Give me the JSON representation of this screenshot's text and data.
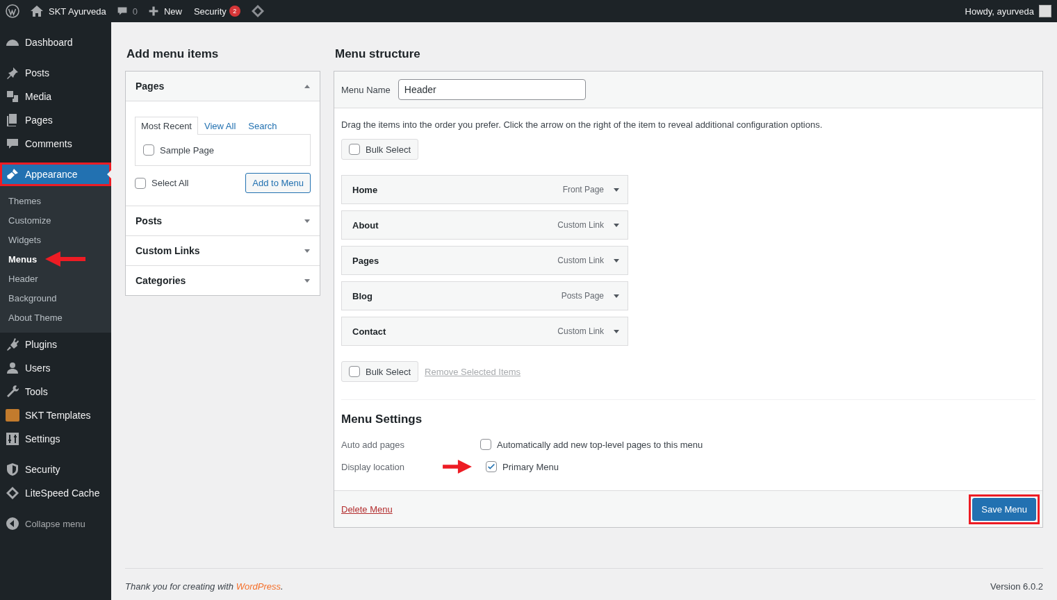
{
  "admin_bar": {
    "site_name": "SKT Ayurveda",
    "comments_count": "0",
    "new_label": "New",
    "security_label": "Security",
    "security_badge": "2",
    "greeting": "Howdy, ayurveda"
  },
  "sidebar": {
    "groups": [
      {
        "items": [
          {
            "label": "Dashboard",
            "selected": false,
            "highlighted": false
          }
        ]
      },
      {
        "items": [
          {
            "label": "Posts",
            "selected": false,
            "highlighted": false
          },
          {
            "label": "Media",
            "selected": false,
            "highlighted": false
          },
          {
            "label": "Pages",
            "selected": false,
            "highlighted": false
          },
          {
            "label": "Comments",
            "selected": false,
            "highlighted": false
          }
        ]
      },
      {
        "items": [
          {
            "label": "Appearance",
            "selected": true,
            "highlighted": true,
            "children": [
              {
                "label": "Themes",
                "selected": false,
                "arrow": false
              },
              {
                "label": "Customize",
                "selected": false,
                "arrow": false
              },
              {
                "label": "Widgets",
                "selected": false,
                "arrow": false
              },
              {
                "label": "Menus",
                "selected": true,
                "arrow": true
              },
              {
                "label": "Header",
                "selected": false,
                "arrow": false
              },
              {
                "label": "Background",
                "selected": false,
                "arrow": false
              },
              {
                "label": "About Theme",
                "selected": false,
                "arrow": false
              }
            ]
          },
          {
            "label": "Plugins",
            "selected": false,
            "highlighted": false
          },
          {
            "label": "Users",
            "selected": false,
            "highlighted": false
          },
          {
            "label": "Tools",
            "selected": false,
            "highlighted": false
          },
          {
            "label": "SKT Templates",
            "selected": false,
            "highlighted": false
          },
          {
            "label": "Settings",
            "selected": false,
            "highlighted": false
          }
        ]
      },
      {
        "items": [
          {
            "label": "Security",
            "selected": false,
            "highlighted": false
          },
          {
            "label": "LiteSpeed Cache",
            "selected": false,
            "highlighted": false
          }
        ]
      }
    ],
    "collapse_label": "Collapse menu"
  },
  "add_items": {
    "title": "Add menu items",
    "panels": [
      {
        "title": "Pages",
        "expanded": true,
        "tabs": [
          {
            "label": "Most Recent",
            "selected": true
          },
          {
            "label": "View All",
            "selected": false
          },
          {
            "label": "Search",
            "selected": false
          }
        ],
        "items": [
          {
            "label": "Sample Page",
            "checked": false
          }
        ],
        "select_all": {
          "label": "Select All",
          "checked": false
        },
        "button": "Add to Menu"
      },
      {
        "title": "Posts",
        "expanded": false
      },
      {
        "title": "Custom Links",
        "expanded": false
      },
      {
        "title": "Categories",
        "expanded": false
      }
    ]
  },
  "structure": {
    "title": "Menu structure",
    "menu_name_label": "Menu Name",
    "menu_name_value": "Header",
    "instructions": "Drag the items into the order you prefer. Click the arrow on the right of the item to reveal additional configuration options.",
    "bulk_select_top": {
      "label": "Bulk Select",
      "checked": false
    },
    "items": [
      {
        "title": "Home",
        "type": "Front Page"
      },
      {
        "title": "About",
        "type": "Custom Link"
      },
      {
        "title": "Pages",
        "type": "Custom Link"
      },
      {
        "title": "Blog",
        "type": "Posts Page"
      },
      {
        "title": "Contact",
        "type": "Custom Link"
      }
    ],
    "bulk_select_bottom": {
      "label": "Bulk Select",
      "checked": false
    },
    "remove_link": "Remove Selected Items",
    "settings": {
      "title": "Menu Settings",
      "rows": [
        {
          "label": "Auto add pages",
          "options": [
            {
              "label": "Automatically add new top-level pages to this menu",
              "checked": false,
              "arrow": false
            }
          ]
        },
        {
          "label": "Display location",
          "options": [
            {
              "label": "Primary Menu",
              "checked": true,
              "arrow": true
            }
          ]
        }
      ]
    },
    "delete_link": "Delete Menu",
    "save_button": {
      "label": "Save Menu",
      "highlighted": true
    }
  },
  "footer": {
    "thanks": "Thank you for creating with",
    "link": "WordPress",
    "suffix": ".",
    "version": "Version 6.0.2"
  }
}
